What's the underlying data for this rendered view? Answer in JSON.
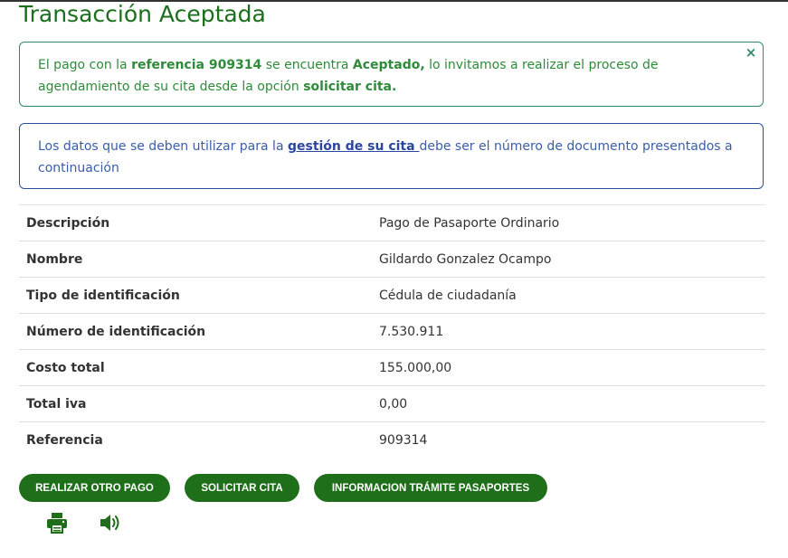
{
  "page": {
    "title": "Transacción Aceptada"
  },
  "alert_success": {
    "text_1": "El pago con la ",
    "reference_label": "referencia 909314",
    "text_2": " se encuentra ",
    "status": "Aceptado,",
    "text_3": " lo invitamos a realizar el proceso de agendamiento de su cita desde la opción ",
    "option": "solicitar cita.",
    "close_glyph": "×"
  },
  "alert_info": {
    "text_1": "Los datos que se deben utilizar para la ",
    "link": "gestión de su cita ",
    "text_2": "debe ser el número de documento presentados a continuación"
  },
  "details": {
    "rows": [
      {
        "label": "Descripción",
        "value": "Pago de Pasaporte Ordinario"
      },
      {
        "label": "Nombre",
        "value": "Gildardo Gonzalez Ocampo"
      },
      {
        "label": "Tipo de identificación",
        "value": "Cédula de ciudadanía"
      },
      {
        "label": "Número de identificación",
        "value": "7.530.911"
      },
      {
        "label": "Costo total",
        "value": "155.000,00"
      },
      {
        "label": "Total iva",
        "value": "0,00"
      },
      {
        "label": "Referencia",
        "value": "909314"
      }
    ]
  },
  "actions": {
    "pay_again": "REALIZAR OTRO PAGO",
    "request_appointment": "SOLICITAR CITA",
    "passport_info": "INFORMACION TRÁMITE PASAPORTES"
  },
  "icons": {
    "print": "print-icon",
    "speaker": "speaker-icon"
  },
  "colors": {
    "title_green": "#1b6e1b",
    "button_green": "#1f6f1a",
    "success_border": "#2e8b6a",
    "success_text": "#2e8b3a",
    "info_border": "#2a4f9a",
    "info_text": "#3a5ea8"
  }
}
